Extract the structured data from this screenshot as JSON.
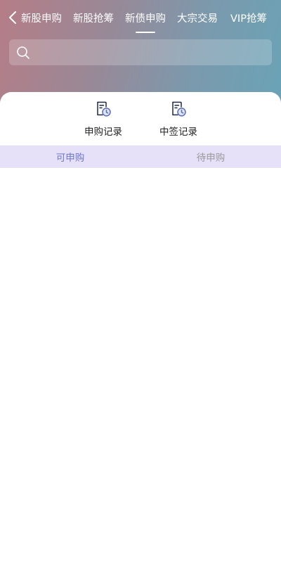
{
  "nav": {
    "tabs": [
      {
        "label": "新股申购"
      },
      {
        "label": "新股抢筹"
      },
      {
        "label": "新债申购"
      },
      {
        "label": "大宗交易"
      },
      {
        "label": "VIP抢筹"
      }
    ],
    "active_tab_index": 2
  },
  "search": {
    "value": "",
    "placeholder": ""
  },
  "quick_actions": [
    {
      "label": "申购记录",
      "icon": "record-clock-icon"
    },
    {
      "label": "中签记录",
      "icon": "record-clock-icon"
    }
  ],
  "subtabs": [
    {
      "label": "可申购"
    },
    {
      "label": "待申购"
    }
  ],
  "active_subtab_index": 0,
  "colors": {
    "header_gradient_start": "#b57d87",
    "header_gradient_end": "#6aa3b6",
    "subtab_bar": "#e6e0f9",
    "subtab_active": "#6a77c8",
    "icon_accent": "#5b6fb3"
  }
}
